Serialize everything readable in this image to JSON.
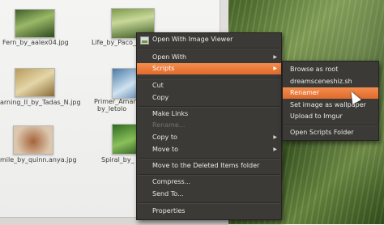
{
  "files": [
    {
      "name": "Fern_by_aalex04.jpg"
    },
    {
      "name": "Life_by_Paco_E"
    },
    {
      "name": "arning_II_by_Tadas_N.jpg"
    },
    {
      "name": "Primer_Aman"
    },
    {
      "name": "by_letolo"
    },
    {
      "name": "mile_by_quinn.anya.jpg"
    },
    {
      "name": "Spiral_by_"
    }
  ],
  "context_menu": {
    "items": [
      {
        "label": "Open With Image Viewer"
      },
      {
        "label": "Open With"
      },
      {
        "label": "Scripts"
      },
      {
        "label": "Cut"
      },
      {
        "label": "Copy"
      },
      {
        "label": "Make Links"
      },
      {
        "label": "Rename..."
      },
      {
        "label": "Copy to"
      },
      {
        "label": "Move to"
      },
      {
        "label": "Move to the Deleted Items folder"
      },
      {
        "label": "Compress..."
      },
      {
        "label": "Send To..."
      },
      {
        "label": "Properties"
      }
    ]
  },
  "scripts_submenu": {
    "items": [
      {
        "label": "Browse as root"
      },
      {
        "label": "dreamsceneshiz.sh"
      },
      {
        "label": "Renamer"
      },
      {
        "label": "Set image as wallpaper"
      },
      {
        "label": "Upload to Imgur"
      },
      {
        "label": "Open Scripts Folder"
      }
    ]
  },
  "colors": {
    "highlight": "#f07a3a",
    "menu_bg": "#3b3a37",
    "menu_text": "#ebeae7"
  }
}
